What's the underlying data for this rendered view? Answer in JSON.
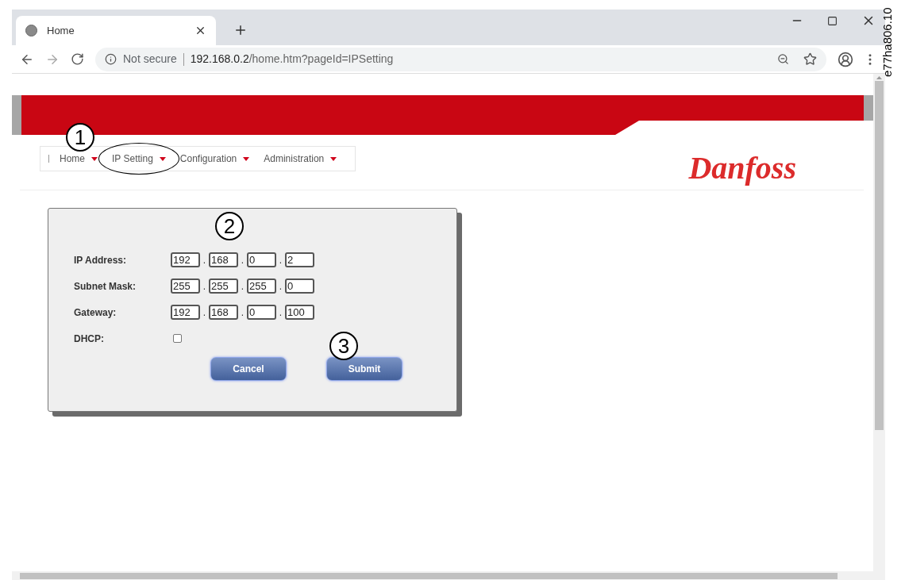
{
  "browser": {
    "tab_title": "Home",
    "security": "Not secure",
    "host": "192.168.0.2",
    "path": "/home.htm?pageId=IPSetting"
  },
  "side_label": "e77ha806.10",
  "logo": "Danfoss",
  "nav": [
    {
      "label": "Home",
      "selected": false,
      "callout": "1"
    },
    {
      "label": "IP Setting",
      "selected": true
    },
    {
      "label": "Configuration",
      "selected": false
    },
    {
      "label": "Administration",
      "selected": false
    }
  ],
  "form": {
    "callout": "2",
    "separator": ".",
    "rows": [
      {
        "label": "IP Address:",
        "octets": [
          "192",
          "168",
          "0",
          "2"
        ]
      },
      {
        "label": "Subnet Mask:",
        "octets": [
          "255",
          "255",
          "255",
          "0"
        ]
      },
      {
        "label": "Gateway:",
        "octets": [
          "192",
          "168",
          "0",
          "100"
        ]
      }
    ],
    "dhcp": {
      "label": "DHCP:",
      "checked": false
    },
    "buttons": [
      {
        "label": "Cancel"
      },
      {
        "label": "Submit",
        "callout": "3"
      }
    ]
  }
}
